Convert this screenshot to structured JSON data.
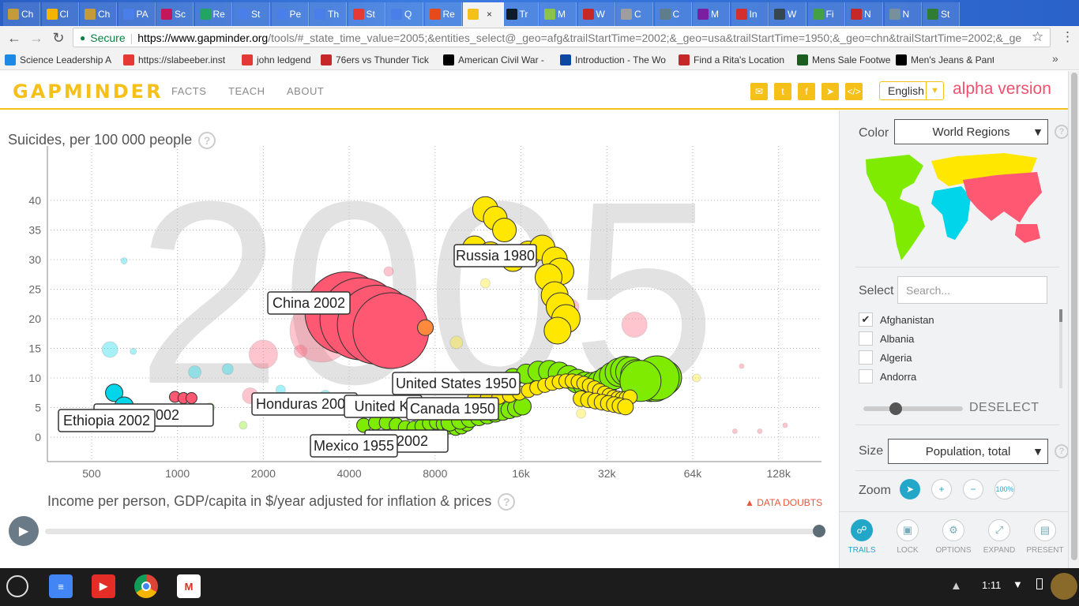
{
  "browser": {
    "tabs": [
      {
        "label": "Ch",
        "color": "#c49a3a"
      },
      {
        "label": "Cl",
        "color": "#f6b400"
      },
      {
        "label": "Ch",
        "color": "#c49a3a"
      },
      {
        "label": "PA",
        "color": "#4a7ee8"
      },
      {
        "label": "Sc",
        "color": "#c2185b"
      },
      {
        "label": "Re",
        "color": "#21a464"
      },
      {
        "label": "St",
        "color": "#4a7ee8"
      },
      {
        "label": "Pe",
        "color": "#4a7ee8"
      },
      {
        "label": "Th",
        "color": "#4a7ee8"
      },
      {
        "label": "St",
        "color": "#e53935"
      },
      {
        "label": "Q",
        "color": "#4a7ee8"
      },
      {
        "label": "Re",
        "color": "#e64a19"
      },
      {
        "label": "",
        "color": "#f6c01a"
      },
      {
        "label": "Tr",
        "color": "#0d1b2a"
      },
      {
        "label": "M",
        "color": "#8bc34a"
      },
      {
        "label": "W",
        "color": "#c62828"
      },
      {
        "label": "C",
        "color": "#9e9e9e"
      },
      {
        "label": "C",
        "color": "#607d8b"
      },
      {
        "label": "M",
        "color": "#7b1fa2"
      },
      {
        "label": "In",
        "color": "#d32f2f"
      },
      {
        "label": "W",
        "color": "#37474f"
      },
      {
        "label": "Fi",
        "color": "#43a047"
      },
      {
        "label": "N",
        "color": "#c62828"
      },
      {
        "label": "N",
        "color": "#78909c"
      },
      {
        "label": "St",
        "color": "#2e7d32"
      }
    ],
    "secure_label": "Secure",
    "url_host": "https://www.gapminder.org",
    "url_rest": "/tools/#_state_time_value=2005;&entities_select@_geo=afg&trailStartTime=2002;&_geo=usa&trailStartTime=1950;&_geo=chn&trailStartTime=2002;&_ge",
    "bookmarks": [
      {
        "label": "Science Leadership A",
        "color": "#1e88e5"
      },
      {
        "label": "https://slabeeber.inst",
        "color": "#e53935"
      },
      {
        "label": "john ledgend",
        "color": "#e53935"
      },
      {
        "label": "76ers vs Thunder Tick",
        "color": "#c62828"
      },
      {
        "label": "American Civil War - ",
        "color": "#000000"
      },
      {
        "label": "Introduction - The Wo",
        "color": "#0d47a1"
      },
      {
        "label": "Find a Rita's Location",
        "color": "#c62828"
      },
      {
        "label": "Mens Sale Footwear",
        "color": "#1b5e20"
      },
      {
        "label": "Men's Jeans & Pants",
        "color": "#000000"
      }
    ]
  },
  "header": {
    "logo": "GAPMINDER",
    "nav": [
      "FACTS",
      "TEACH",
      "ABOUT"
    ],
    "language": "English",
    "alpha": "alpha version",
    "social_icons": [
      "mail-icon",
      "twitter-icon",
      "facebook-icon",
      "telegram-icon",
      "code-icon"
    ]
  },
  "chart": {
    "y_title": "Suicides, per 100 000 people",
    "x_title": "Income per person, GDP/capita in $/year adjusted for inflation & prices",
    "year": "2005",
    "data_doubts": "DATA DOUBTS",
    "y_ticks": [
      "0",
      "5",
      "10",
      "15",
      "20",
      "25",
      "30",
      "35",
      "40"
    ],
    "x_ticks": [
      "500",
      "1000",
      "2000",
      "4000",
      "8000",
      "16k",
      "32k",
      "64k",
      "128k"
    ],
    "labels": [
      "Russia 1980",
      "China 2002",
      "United States 1950",
      "Honduras 2002",
      "United Ki",
      "Canada 1950",
      "Ethiopia 2002",
      "an 2002",
      "Mexico 1955",
      "e 2002"
    ]
  },
  "side_panel": {
    "color_label": "Color",
    "color_value": "World Regions",
    "select_label": "Select",
    "search_placeholder": "Search...",
    "countries": [
      {
        "name": "Afghanistan",
        "checked": true
      },
      {
        "name": "Albania",
        "checked": false
      },
      {
        "name": "Algeria",
        "checked": false
      },
      {
        "name": "Andorra",
        "checked": false
      }
    ],
    "deselect": "DESELECT",
    "size_label": "Size",
    "size_value": "Population, total",
    "zoom_label": "Zoom",
    "zoom_100": "100%",
    "tools": [
      {
        "label": "TRAILS",
        "icon": "trails-icon"
      },
      {
        "label": "LOCK",
        "icon": "lock-icon"
      },
      {
        "label": "OPTIONS",
        "icon": "gear-icon"
      },
      {
        "label": "EXPAND",
        "icon": "expand-icon"
      },
      {
        "label": "PRESENT",
        "icon": "present-icon"
      }
    ]
  },
  "shelf": {
    "clock": "1:11",
    "apps": [
      "launcher-icon",
      "docs-icon",
      "youtube-icon",
      "chrome-icon",
      "gmail-icon"
    ]
  },
  "colors": {
    "gapminder_yellow": "#f6c01a",
    "alpha_pink": "#f0506e",
    "asia_red": "#ff5872",
    "europe_yellow": "#ffe700",
    "americas_green": "#7feb00",
    "africa_cyan": "#00d5e9",
    "trails_blue": "#23a7c9"
  }
}
